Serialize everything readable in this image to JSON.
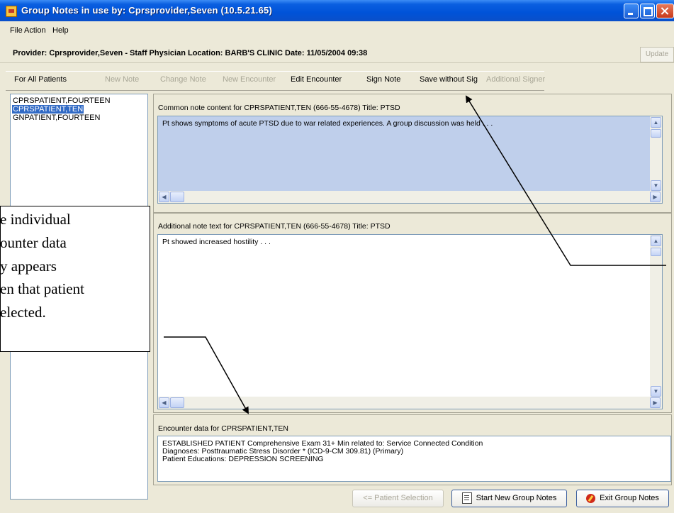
{
  "window": {
    "title": "Group Notes in use by: Cprsprovider,Seven  (10.5.21.65)",
    "icon": "app-icon"
  },
  "menu": {
    "file": "File",
    "action": "Action",
    "help": "Help"
  },
  "provider_bar": {
    "text": "Provider: Cprsprovider,Seven - Staff Physician  Location: BARB'S CLINIC  Date: 11/05/2004 09:38",
    "update_label": "Update"
  },
  "actions": {
    "for_all_patients": "For All Patients",
    "new_note": "New Note",
    "change_note": "Change Note",
    "new_encounter": "New Encounter",
    "edit_encounter": "Edit Encounter",
    "sign_note": "Sign Note",
    "save_without_sig": "Save without Sig",
    "additional_signer": "Additional Signer"
  },
  "patients": [
    "CPRSPATIENT,FOURTEEN",
    "CPRSPATIENT,TEN",
    "GNPATIENT,FOURTEEN"
  ],
  "selected_patient_index": 1,
  "common_note": {
    "label": "Common note content for CPRSPATIENT,TEN (666-55-4678)  Title: PTSD",
    "text": "Pt shows symptoms of acute PTSD due to war related experiences.  A group discussion was held . . ."
  },
  "additional_note": {
    "label": "Additional note text for CPRSPATIENT,TEN (666-55-4678)  Title: PTSD",
    "text": "Pt showed increased hostility . . ."
  },
  "encounter": {
    "label": "Encounter data for CPRSPATIENT,TEN",
    "lines": [
      "ESTABLISHED PATIENT Comprehensive Exam   31+ Min related to:  Service Connected Condition",
      "Diagnoses: Posttraumatic Stress Disorder * (ICD-9-CM 309.81) (Primary)",
      "Patient Educations: DEPRESSION SCREENING"
    ]
  },
  "bottom_buttons": {
    "patient_selection": "<= Patient Selection",
    "start_new_group_notes": "Start New Group Notes",
    "exit_group_notes": "Exit Group Notes"
  },
  "callout": {
    "lines": [
      "e individual",
      "ounter data",
      "y appears",
      "en that patient",
      "elected."
    ]
  },
  "colors": {
    "titlebar": "#0053d8",
    "window_bg": "#ece9d8",
    "selection": "#316ac5",
    "memo_highlight": "#bfcfeb"
  }
}
